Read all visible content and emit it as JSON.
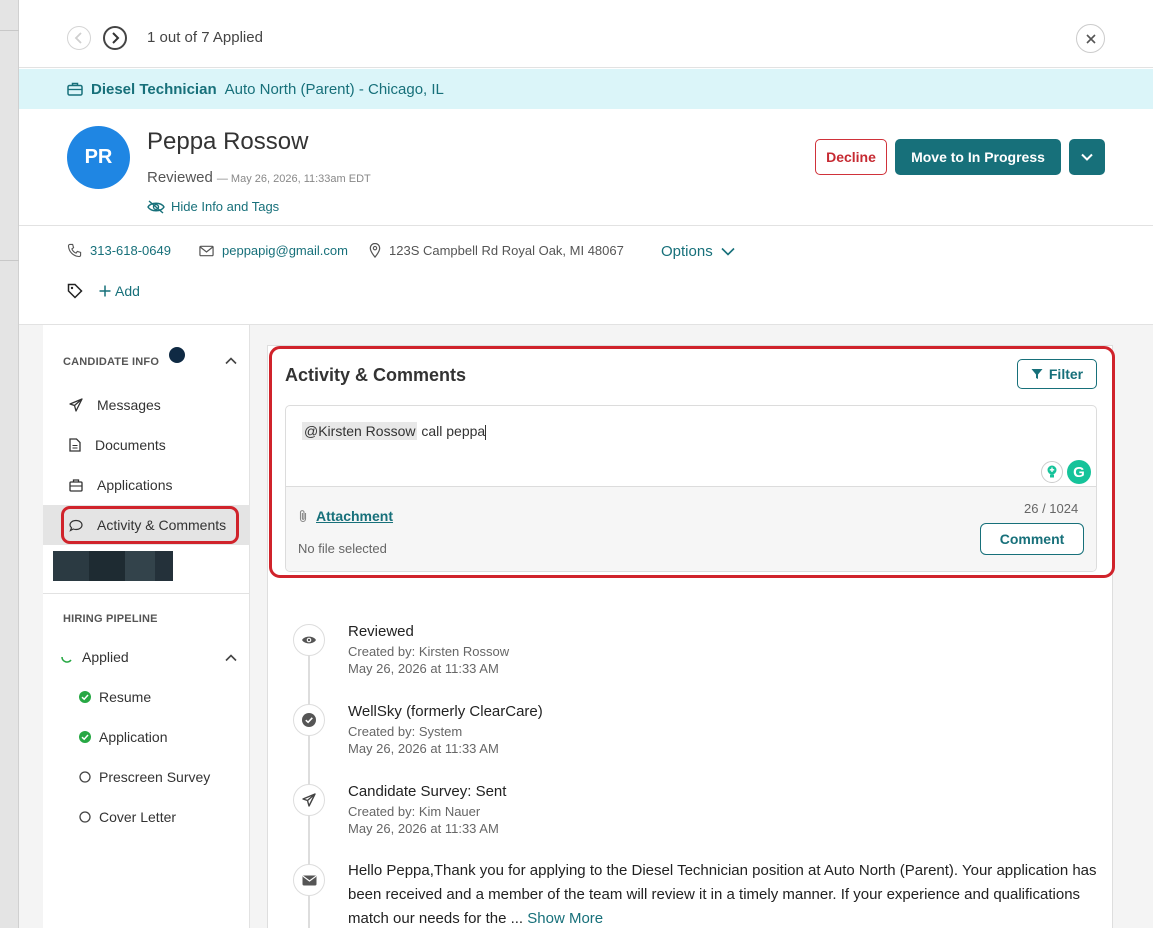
{
  "nav": {
    "counter": "1 out of 7 Applied"
  },
  "job": {
    "title": "Diesel Technician",
    "location": "Auto North (Parent) - Chicago, IL"
  },
  "candidate": {
    "initials": "PR",
    "name": "Peppa Rossow",
    "status": "Reviewed",
    "status_timestamp": "— May 26, 2026, 11:33am EDT",
    "hide_info_label": "Hide Info and Tags",
    "phone": "313-618-0649",
    "email": "peppapig@gmail.com",
    "address": "123S Campbell Rd Royal Oak, MI 48067",
    "options_label": "Options",
    "add_tag_label": "Add"
  },
  "actions": {
    "decline": "Decline",
    "move": "Move to In Progress"
  },
  "sidebar": {
    "candidate_info_title": "CANDIDATE INFO",
    "items": [
      {
        "label": "Messages",
        "icon": "paper-plane-icon"
      },
      {
        "label": "Documents",
        "icon": "document-icon"
      },
      {
        "label": "Applications",
        "icon": "briefcase-icon"
      },
      {
        "label": "Activity & Comments",
        "icon": "comment-icon",
        "active": true
      }
    ],
    "pipeline_title": "HIRING PIPELINE",
    "pipeline_stage": "Applied",
    "pipeline_steps": [
      {
        "label": "Resume",
        "done": true
      },
      {
        "label": "Application",
        "done": true
      },
      {
        "label": "Prescreen Survey",
        "done": false
      },
      {
        "label": "Cover Letter",
        "done": false
      }
    ]
  },
  "activity": {
    "title": "Activity & Comments",
    "filter_label": "Filter",
    "comment_mention": "@Kirsten Rossow",
    "comment_rest": " call peppa",
    "attachment_label": "Attachment",
    "no_file": "No file selected",
    "char_count": "26 / 1024",
    "comment_button": "Comment",
    "entries": [
      {
        "title": "Reviewed",
        "created_by": "Created by: Kirsten Rossow",
        "date": "May 26, 2026 at 11:33 AM",
        "icon": "eye-icon"
      },
      {
        "title": "WellSky (formerly ClearCare)",
        "created_by": "Created by: System",
        "date": "May 26, 2026 at 11:33 AM",
        "icon": "check-circle-icon"
      },
      {
        "title": "Candidate Survey: Sent",
        "created_by": "Created by: Kim Nauer",
        "date": "May 26, 2026 at 11:33 AM",
        "icon": "paper-plane-icon"
      }
    ],
    "message_text": "Hello Peppa,Thank you for applying to the Diesel Technician position at Auto North (Parent). Your application has been received and a member of the team will review it in a timely manner. If your experience and qualifications match our needs for the ... ",
    "show_more": "Show More"
  },
  "colors": {
    "teal": "#17707a",
    "decline_red": "#c62a32",
    "avatar_blue": "#1f86e3",
    "banner_bg": "#dbf5f9",
    "highlight_red": "#d0232b"
  }
}
